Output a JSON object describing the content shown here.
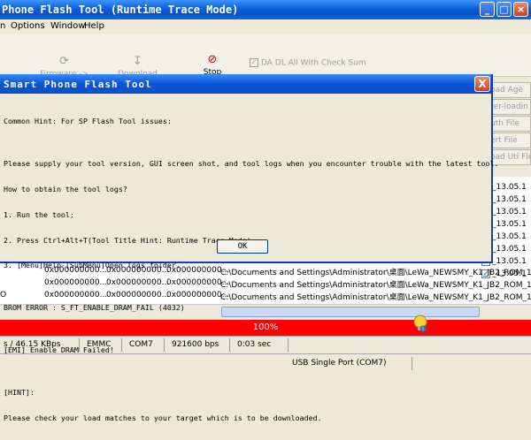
{
  "window": {
    "title": "Phone Flash Tool (Runtime Trace Mode)"
  },
  "menu": {
    "items": [
      "n",
      "Options",
      "Window",
      "Help"
    ]
  },
  "toolbar": {
    "firmware_upgrade": "Firmware -> Upgrade",
    "download": "Download",
    "stop": "Stop",
    "da_checksum": "DA DL All With Check Sum"
  },
  "right_panel": {
    "buttons": [
      "oad Age",
      "ter-loadin",
      "uth File",
      "ert File",
      "oad Uti Fle"
    ],
    "rom_names": [
      "_13.05.1",
      "_13.05.1",
      "_13.05.1",
      "_13.05.1",
      "_13.05.1",
      "_13.05.1",
      "_13.05.1",
      "_13.05.1"
    ]
  },
  "table": {
    "rows": [
      {
        "lead": "",
        "c1": "0x000000000...",
        "c2": "0x000000000...",
        "c3": "0x000000000...",
        "path": "C:\\Documents and Settings\\Administrator\\桌面\\LeWa_NEWSMY_K1_JB2_ROM_13.05.1"
      },
      {
        "lead": "",
        "c1": "0x000000000...",
        "c2": "0x000000000...",
        "c3": "0x000000000...",
        "path": "C:\\Documents and Settings\\Administrator\\桌面\\LeWa_NEWSMY_K1_JB2_ROM_13.05.1"
      },
      {
        "lead": "O",
        "c1": "0x000000000...",
        "c2": "0x000000000...",
        "c3": "0x000000000...",
        "path": "C:\\Documents and Settings\\Administrator\\桌面\\LeWa_NEWSMY_K1_JB2_ROM_13.05.1"
      }
    ]
  },
  "progress": {
    "label": "100%",
    "value": 1.0,
    "color": "#ff0000"
  },
  "status": {
    "speed": "s / 46.15 KBps",
    "storage": "EMMC",
    "port": "COM7",
    "baud": "921600 bps",
    "time": "0:03 sec",
    "usb": "USB Single Port (COM7)"
  },
  "dialog": {
    "title": "Smart Phone Flash Tool",
    "lines": [
      "Common Hint: For SP Flash Tool issues:",
      "",
      "Please supply your tool version, GUI screen shot, and tool logs when you encounter trouble with the latest tool.",
      "How to obtain the tool logs?",
      "1. Run the tool;",
      "2. Press Ctrl+Alt+T(Tool Title Hint: Runtime Trace Mode);",
      "3. [Menu]Help-[SubMenu]Open logs folder.",
      "",
      "BROM ERROR : S_FT_ENABLE_DRAM_FAIL (4032)",
      "",
      "[EMI] Enable DRAM Failed!",
      "",
      "[HINT]:",
      "Please check your load matches to your target which is to be downloaded."
    ],
    "ok_label": "OK",
    "close_label": "X"
  },
  "colors": {
    "titlebar": "#0a5fd8",
    "dialog_border": "#0a3fbf",
    "progress": "#ff0000"
  }
}
